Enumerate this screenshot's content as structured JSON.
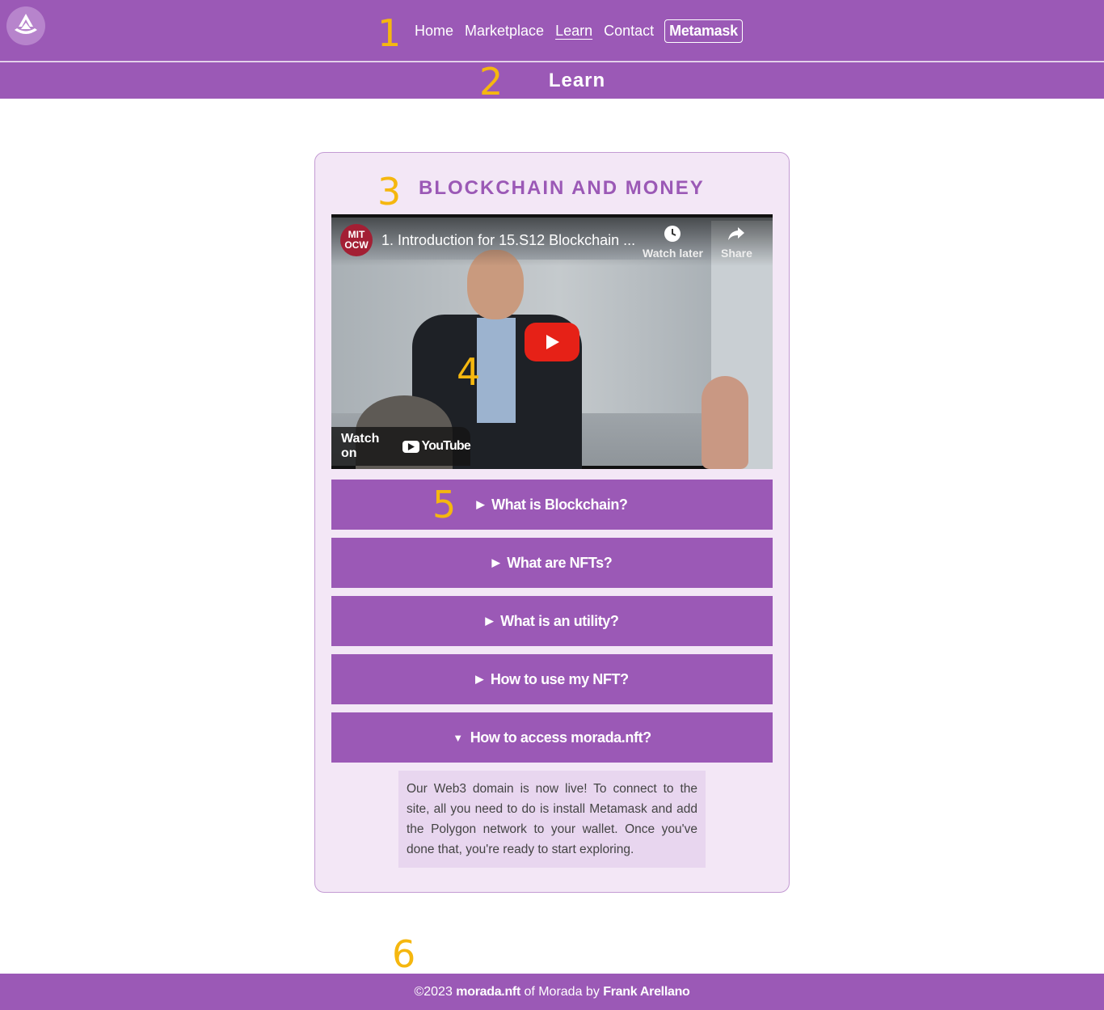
{
  "colors": {
    "brand": "#9b59b6",
    "annotation": "#f5b70f",
    "card_bg": "#f3e7f6",
    "answer_bg": "#e8d6ef"
  },
  "nav": {
    "logo_icon": "morada-logo-icon",
    "links": [
      "Home",
      "Marketplace",
      "Learn",
      "Contact"
    ],
    "active": "Learn",
    "metamask": "Metamask"
  },
  "header": {
    "title": "Learn"
  },
  "annotations": [
    "1",
    "2",
    "3",
    "4",
    "5",
    "6"
  ],
  "section": {
    "title": "BLOCKCHAIN AND MONEY",
    "video": {
      "channel": "MIT OCW",
      "title": "1. Introduction for 15.S12 Blockchain ...",
      "watch_later": "Watch later",
      "share": "Share",
      "watch_on": "Watch on",
      "youtube": "YouTube"
    },
    "faq": [
      {
        "q": "What is Blockchain?",
        "open": false
      },
      {
        "q": "What are NFTs?",
        "open": false
      },
      {
        "q": "What is an utility?",
        "open": false
      },
      {
        "q": "How to use my NFT?",
        "open": false
      },
      {
        "q": "How to access morada.nft?",
        "open": true
      }
    ],
    "answer": "Our Web3 domain is now live! To connect to the site, all you need to do is install Metamask and add the Polygon network to your wallet. Once you've done that, you're ready to start exploring."
  },
  "footer": {
    "copyright": "©2023",
    "site": "morada.nft",
    "middle": "of Morada by",
    "author": "Frank Arellano"
  }
}
